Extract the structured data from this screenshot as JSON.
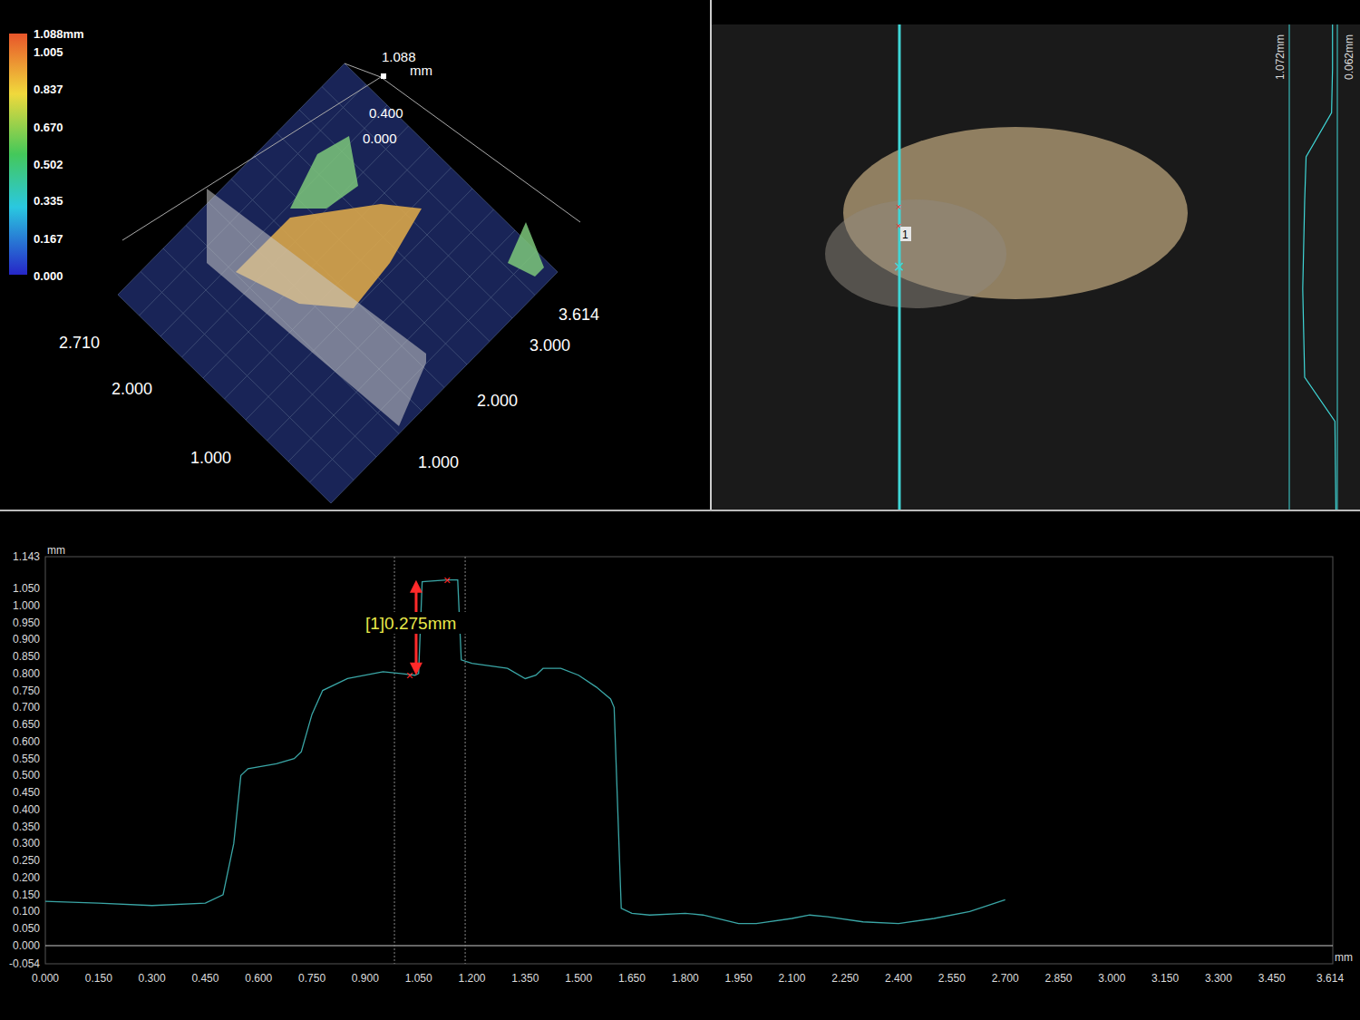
{
  "view3d": {
    "colorbar": {
      "ticks": [
        "1.088mm",
        "1.005",
        "0.837",
        "0.670",
        "0.502",
        "0.335",
        "0.167",
        "0.000"
      ]
    },
    "z_axis": {
      "max": "1.088",
      "unit": "mm",
      "ticks": [
        "0.400",
        "0.000"
      ]
    },
    "y_axis_ticks": [
      "2.710",
      "2.000",
      "1.000"
    ],
    "x_axis_ticks": [
      "3.614",
      "3.000",
      "2.000",
      "1.000"
    ]
  },
  "image_view": {
    "profile_labels": [
      "1.072mm",
      "0.062mm"
    ],
    "marker": "1",
    "mini_profile": [
      0.9,
      0.9,
      0.88,
      0.35,
      0.32,
      0.3,
      0.28,
      0.3,
      0.32,
      0.95,
      0.96,
      0.97
    ]
  },
  "profile_chart": {
    "y_unit": "mm",
    "x_unit": "mm",
    "y_ticks": [
      "-0.054",
      "0.000",
      "0.050",
      "0.100",
      "0.150",
      "0.200",
      "0.250",
      "0.300",
      "0.350",
      "0.400",
      "0.450",
      "0.500",
      "0.550",
      "0.600",
      "0.650",
      "0.700",
      "0.750",
      "0.800",
      "0.850",
      "0.900",
      "0.950",
      "1.000",
      "1.050",
      "1.143"
    ],
    "x_ticks": [
      "0.000",
      "0.150",
      "0.300",
      "0.450",
      "0.600",
      "0.750",
      "0.900",
      "1.050",
      "1.200",
      "1.350",
      "1.500",
      "1.650",
      "1.800",
      "1.950",
      "2.100",
      "2.250",
      "2.400",
      "2.550",
      "2.700",
      "2.850",
      "3.000",
      "3.150",
      "3.300",
      "3.450",
      "3.614"
    ],
    "series": {
      "x": [
        0,
        0.15,
        0.3,
        0.45,
        0.5,
        0.53,
        0.55,
        0.57,
        0.65,
        0.7,
        0.72,
        0.75,
        0.78,
        0.85,
        0.95,
        1.0,
        1.04,
        1.05,
        1.06,
        1.13,
        1.16,
        1.17,
        1.2,
        1.3,
        1.35,
        1.38,
        1.4,
        1.45,
        1.5,
        1.55,
        1.59,
        1.6,
        1.62,
        1.65,
        1.7,
        1.8,
        1.85,
        1.95,
        2.0,
        2.1,
        2.15,
        2.2,
        2.3,
        2.4,
        2.5,
        2.6,
        2.7
      ],
      "y": [
        0.13,
        0.125,
        0.118,
        0.125,
        0.15,
        0.3,
        0.5,
        0.52,
        0.535,
        0.55,
        0.57,
        0.68,
        0.75,
        0.785,
        0.805,
        0.8,
        0.795,
        0.8,
        1.07,
        1.075,
        1.075,
        0.84,
        0.83,
        0.815,
        0.785,
        0.795,
        0.815,
        0.815,
        0.795,
        0.76,
        0.725,
        0.7,
        0.11,
        0.095,
        0.09,
        0.095,
        0.09,
        0.065,
        0.065,
        0.08,
        0.09,
        0.085,
        0.07,
        0.065,
        0.08,
        0.1,
        0.135
      ]
    },
    "measurement": {
      "label": "[1]0.275mm",
      "from": [
        1.03,
        0.795
      ],
      "to": [
        1.135,
        1.075
      ]
    },
    "cursors": [
      0.982,
      1.181
    ]
  }
}
